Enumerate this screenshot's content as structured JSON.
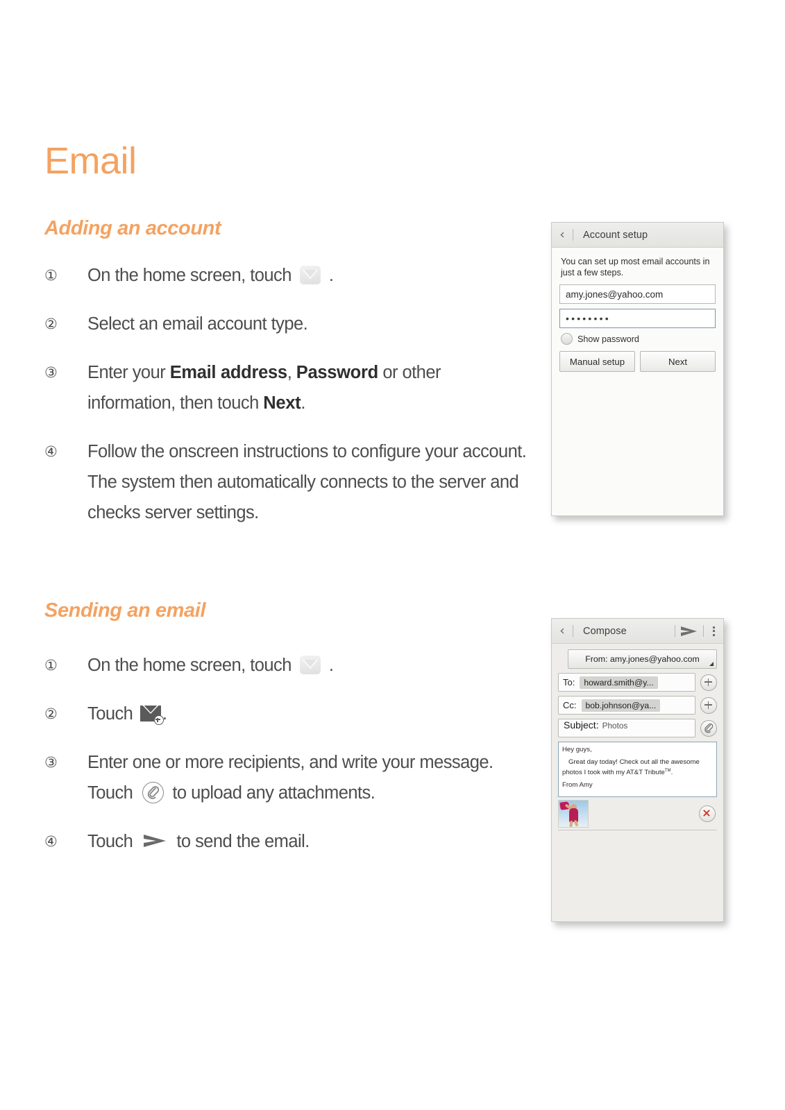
{
  "page": {
    "title": "Email"
  },
  "colors": {
    "accent_orange": "#F4A261",
    "body_text": "#4d4d4d",
    "panel_border": "#c9c9c4"
  },
  "sections": [
    {
      "id": "adding",
      "heading": "Adding an account",
      "steps": [
        {
          "num": "①",
          "pre": "On the home screen, touch ",
          "icon": "envelope-light-icon",
          "post": " ."
        },
        {
          "num": "②",
          "pre": "Select an email account type.",
          "icon": null,
          "post": ""
        },
        {
          "num": "③",
          "pre": "Enter your ",
          "bold1": "Email address",
          "mid": ", ",
          "bold2": "Password",
          "mid2": " or other information, then touch ",
          "bold3": "Next",
          "post": "."
        },
        {
          "num": "④",
          "pre": "Follow the onscreen instructions to configure your account. The system then automatically connects to the server and checks server settings.",
          "icon": null,
          "post": ""
        }
      ]
    },
    {
      "id": "sending",
      "heading": "Sending an email",
      "steps": [
        {
          "num": "①",
          "pre": "On the home screen, touch ",
          "icon": "envelope-light-icon",
          "post": " ."
        },
        {
          "num": "②",
          "pre": "Touch ",
          "icon": "compose-envelope-icon",
          "post": "."
        },
        {
          "num": "③",
          "pre": "Enter one or more recipients, and write your message. Touch ",
          "icon": "paperclip-circle-icon",
          "post": " to upload any attachments."
        },
        {
          "num": "④",
          "pre": "Touch ",
          "icon": "send-arrow-icon",
          "post": " to send the email."
        }
      ]
    }
  ],
  "account_setup_screen": {
    "titlebar": {
      "back_icon": "chevron-left-icon",
      "title": "Account setup"
    },
    "intro": "You can set up most email accounts in just a few steps.",
    "email_field": {
      "value": "amy.jones@yahoo.com",
      "placeholder": "Email address"
    },
    "password_field": {
      "value": "••••••••",
      "placeholder": "Password"
    },
    "show_password_label": "Show password",
    "buttons": {
      "manual_setup": "Manual setup",
      "next": "Next"
    }
  },
  "compose_screen": {
    "titlebar": {
      "back_icon": "chevron-left-icon",
      "title": "Compose",
      "send_icon": "send-arrow-icon",
      "more_icon": "kebab-menu-icon"
    },
    "from": {
      "label": "From:",
      "value": "amy.jones@yahoo.com",
      "full": "From: amy.jones@yahoo.com"
    },
    "to": {
      "label": "To:",
      "chip": "howard.smith@y...",
      "add_icon": "add-contact-icon"
    },
    "cc": {
      "label": "Cc:",
      "chip": "bob.johnson@ya...",
      "add_icon": "add-contact-icon"
    },
    "subject": {
      "label": "Subject:",
      "value": "Photos",
      "attach_icon": "paperclip-icon"
    },
    "message": {
      "line1": "Hey guys,",
      "line2": "Great day today! Check out all the awesome photos I took with my AT&T Tribute",
      "line2_sup": "TM",
      "line2_end": ".",
      "line3": "From Amy"
    },
    "attachment": {
      "thumbnail_alt": "photo-thumbnail",
      "remove_icon": "remove-attachment-icon"
    }
  }
}
